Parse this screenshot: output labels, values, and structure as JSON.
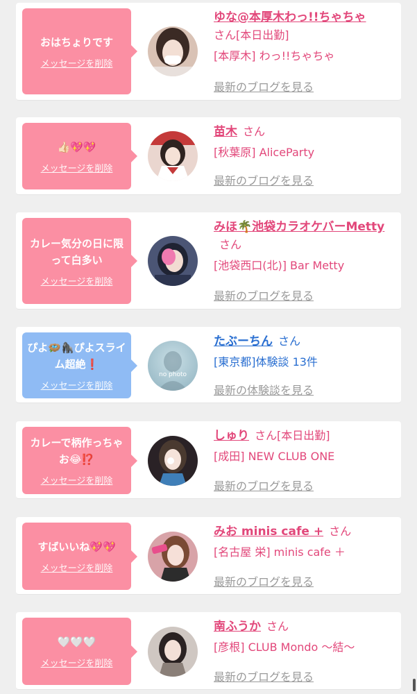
{
  "items": [
    {
      "message": "おはちょりです",
      "delete_label": "メッセージを削除",
      "name": "ゆな@本厚木わっ!!ちゃちゃ",
      "honorific": "さん",
      "status": "[本日出勤]",
      "shop": "[本厚木] わっ!!ちゃちゃ",
      "link": "最新のブログを見る",
      "bubble_color": "#fb8fa3",
      "text_color": "#e2477a"
    },
    {
      "message": "👍🏻💖💖",
      "delete_label": "メッセージを削除",
      "name": "苗木",
      "honorific": "さん",
      "status": "",
      "shop": "[秋葉原] AliceParty",
      "link": "最新のブログを見る",
      "bubble_color": "#fb8fa3",
      "text_color": "#e2477a"
    },
    {
      "message": "カレー気分の日に限って白多い",
      "delete_label": "メッセージを削除",
      "name": "みほ🌴池袋カラオケバーMetty",
      "honorific": "さん",
      "status": "",
      "shop": "[池袋西口(北)] Bar Metty",
      "link": "最新のブログを見る",
      "bubble_color": "#fb8fa3",
      "text_color": "#e2477a"
    },
    {
      "message": "ぴよ🪺🦍ぴよスライム超絶❗",
      "delete_label": "メッセージを削除",
      "name": "たぶーちん",
      "honorific": "さん",
      "status": "",
      "shop": "[東京都]体験談 13件",
      "link": "最新の体験談を見る",
      "avatar_text": "no photo",
      "bubble_color": "#8fbbf4",
      "text_color": "#2a6fd1"
    },
    {
      "message": "カレーで柄作っちゃお😂⁉️",
      "delete_label": "メッセージを削除",
      "name": "しゅり",
      "honorific": "さん",
      "status": "[本日出勤]",
      "shop": "[成田] NEW CLUB ONE",
      "link": "最新のブログを見る",
      "bubble_color": "#fb8fa3",
      "text_color": "#e2477a"
    },
    {
      "message": "すばいいね💖💖",
      "delete_label": "メッセージを削除",
      "name": "みお minis cafe +",
      "honorific": "さん",
      "status": "",
      "shop": "[名古屋 栄] minis cafe ＋",
      "link": "最新のブログを見る",
      "bubble_color": "#fb8fa3",
      "text_color": "#e2477a"
    },
    {
      "message": "🤍🤍🤍",
      "delete_label": "メッセージを削除",
      "name": "南ふうか",
      "honorific": "さん",
      "status": "",
      "shop": "[彦根] CLUB Mondo 〜結〜",
      "link": "最新のブログを見る",
      "bubble_color": "#fb8fa3",
      "text_color": "#e2477a"
    }
  ]
}
